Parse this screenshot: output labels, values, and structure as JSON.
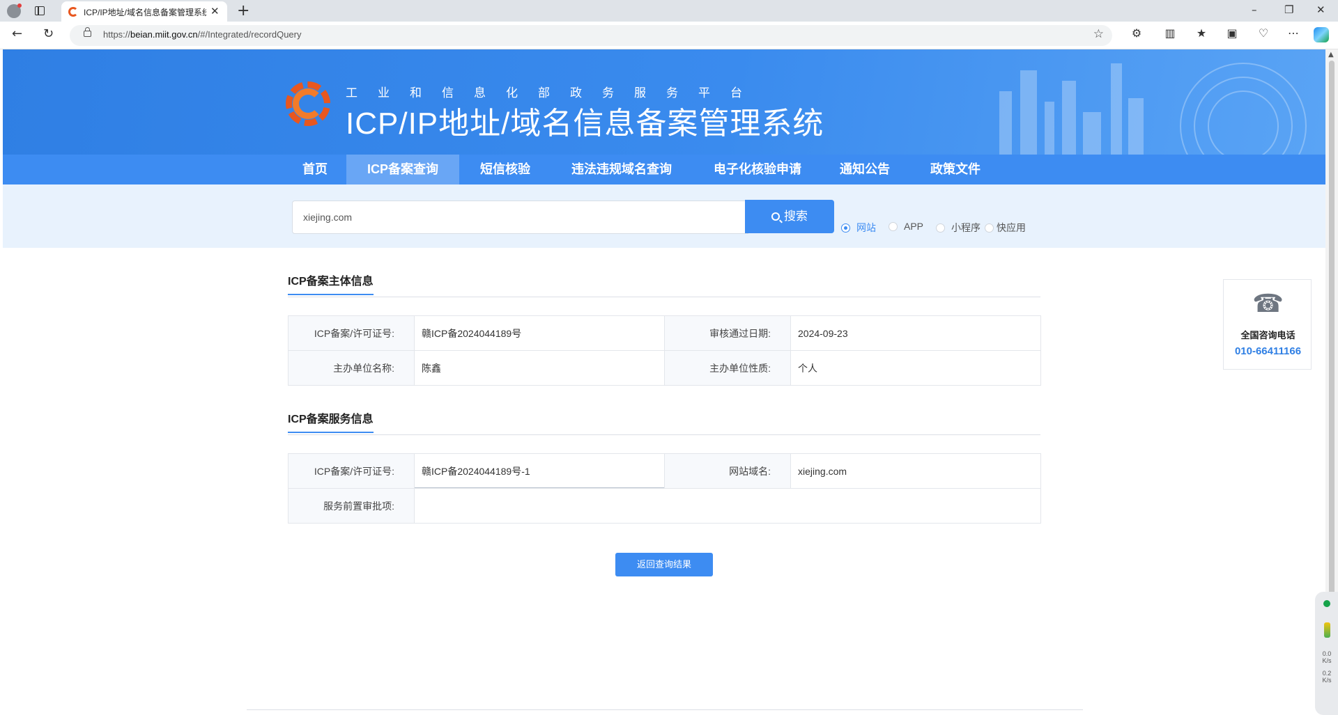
{
  "browser": {
    "tab_title": "ICP/IP地址/域名信息备案管理系统",
    "url_prefix": "https://",
    "url_host": "beian.miit.gov.cn",
    "url_path": "/#/Integrated/recordQuery"
  },
  "header": {
    "subtitle": "工业和信息化部政务服务平台",
    "title": "ICP/IP地址/域名信息备案管理系统"
  },
  "nav": {
    "items": [
      {
        "label": "首页"
      },
      {
        "label": "ICP备案查询"
      },
      {
        "label": "短信核验"
      },
      {
        "label": "违法违规域名查询"
      },
      {
        "label": "电子化核验申请"
      },
      {
        "label": "通知公告"
      },
      {
        "label": "政策文件"
      }
    ],
    "active_index": 1
  },
  "search": {
    "value": "xiejing.com",
    "button_label": "搜索",
    "types": [
      "网站",
      "APP",
      "小程序",
      "快应用"
    ],
    "selected_type": "网站"
  },
  "subject_info": {
    "title": "ICP备案主体信息",
    "license_label": "ICP备案/许可证号:",
    "license_value": "赣ICP备2024044189号",
    "approve_date_label": "审核通过日期:",
    "approve_date_value": "2024-09-23",
    "org_name_label": "主办单位名称:",
    "org_name_value": "陈鑫",
    "org_type_label": "主办单位性质:",
    "org_type_value": "个人"
  },
  "service_info": {
    "title": "ICP备案服务信息",
    "license_label": "ICP备案/许可证号:",
    "license_value": "赣ICP备2024044189号-1",
    "domain_label": "网站域名:",
    "domain_value": "xiejing.com",
    "pre_approval_label": "服务前置审批项:",
    "pre_approval_value": ""
  },
  "back_button_label": "返回查询结果",
  "contact": {
    "icon": "phone-icon",
    "label": "全国咨询电话",
    "number": "010-66411166"
  },
  "side_widget": {
    "upload": "0.0",
    "download": "0.2",
    "unit": "K/s"
  },
  "colors": {
    "primary": "#3d8cf2",
    "banner": "#2f7fe4",
    "logo": "#e8571f"
  }
}
